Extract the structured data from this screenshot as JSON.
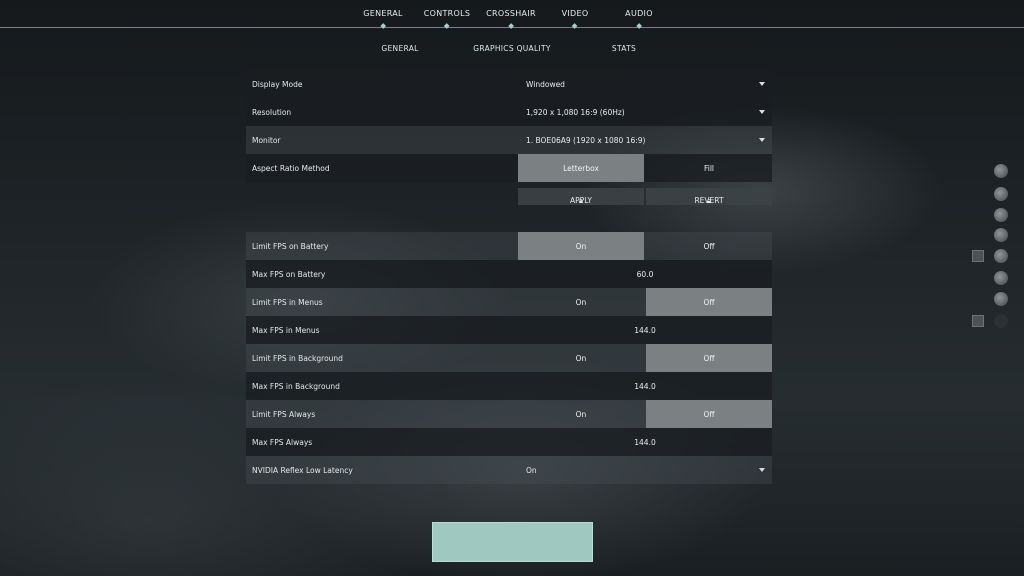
{
  "top_tabs": [
    "GENERAL",
    "CONTROLS",
    "CROSSHAIR",
    "VIDEO",
    "AUDIO"
  ],
  "sub_tabs": [
    "GENERAL",
    "GRAPHICS QUALITY",
    "STATS"
  ],
  "settings": {
    "display_mode": {
      "label": "Display Mode",
      "value": "Windowed"
    },
    "resolution": {
      "label": "Resolution",
      "value": "1,920 x 1,080 16:9 (60Hz)"
    },
    "monitor": {
      "label": "Monitor",
      "value": "1. BOE06A9 (1920 x 1080 16:9)"
    },
    "aspect_ratio": {
      "label": "Aspect Ratio Method",
      "option_a": "Letterbox",
      "option_b": "Fill",
      "selected": "Letterbox"
    },
    "apply_label": "APPLY",
    "revert_label": "REVERT",
    "limit_fps_battery": {
      "label": "Limit FPS on Battery",
      "option_a": "On",
      "option_b": "Off",
      "selected": "On"
    },
    "max_fps_battery": {
      "label": "Max FPS on Battery",
      "value": "60.0"
    },
    "limit_fps_menus": {
      "label": "Limit FPS in Menus",
      "option_a": "On",
      "option_b": "Off",
      "selected": "Off"
    },
    "max_fps_menus": {
      "label": "Max FPS in Menus",
      "value": "144.0"
    },
    "limit_fps_background": {
      "label": "Limit FPS in Background",
      "option_a": "On",
      "option_b": "Off",
      "selected": "Off"
    },
    "max_fps_background": {
      "label": "Max FPS in Background",
      "value": "144.0"
    },
    "limit_fps_always": {
      "label": "Limit FPS Always",
      "option_a": "On",
      "option_b": "Off",
      "selected": "Off"
    },
    "max_fps_always": {
      "label": "Max FPS Always",
      "value": "144.0"
    },
    "nvidia_reflex": {
      "label": "NVIDIA Reflex Low Latency",
      "value": "On"
    }
  },
  "colors": {
    "accent": "#9fc8c0",
    "active_segment": "#7b8083"
  }
}
